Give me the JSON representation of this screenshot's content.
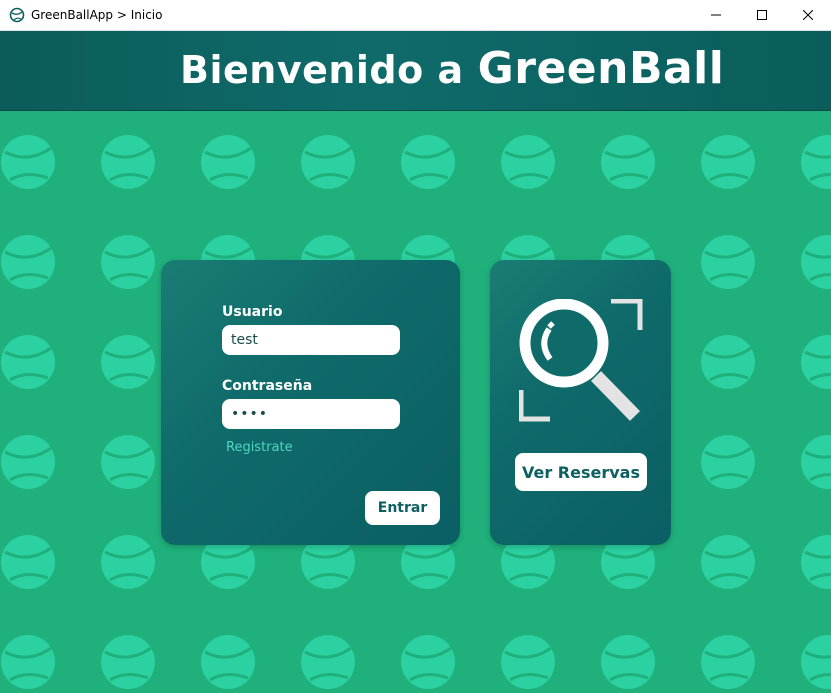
{
  "window": {
    "title": "GreenBallApp > Inicio",
    "controls": [
      "minimize",
      "maximize",
      "close"
    ]
  },
  "header": {
    "welcome": "Bienvenido a",
    "brand": "GreenBall"
  },
  "login": {
    "user_label": "Usuario",
    "user_value": "test",
    "password_label": "Contraseña",
    "password_value": "••••",
    "register_link": "Registrate",
    "submit_label": "Entrar"
  },
  "reservations": {
    "icon": "magnifier-scan-icon",
    "button_label": "Ver Reservas"
  },
  "colors": {
    "background": "#1fb07b",
    "pattern_ball": "#2bd1a0",
    "header": "#0b5c5a",
    "panel": "#0f6a6a",
    "link": "#4fd6c0",
    "button_text": "#0e5f61"
  }
}
